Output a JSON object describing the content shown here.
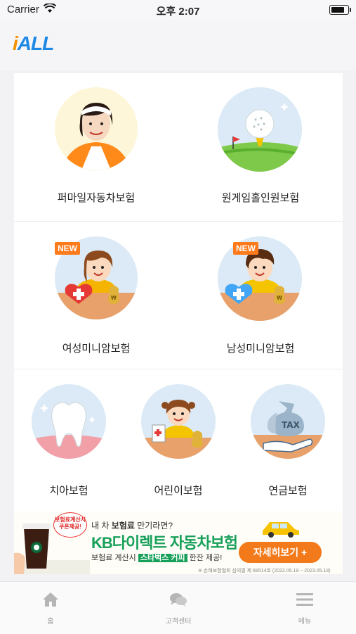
{
  "status_bar": {
    "carrier": "Carrier",
    "time": "오후 2:07"
  },
  "header": {
    "logo_prefix": "i",
    "logo_suffix": "ALL"
  },
  "products": {
    "row1": [
      {
        "label": "퍼마일자동차보험",
        "icon": "woman-driver-icon"
      },
      {
        "label": "원게임홀인원보험",
        "icon": "golf-ball-icon"
      }
    ],
    "row2": [
      {
        "label": "여성미니암보험",
        "badge": "NEW",
        "icon": "woman-heart-icon"
      },
      {
        "label": "남성미니암보험",
        "badge": "NEW",
        "icon": "man-heart-icon"
      }
    ],
    "row3": [
      {
        "label": "치아보험",
        "icon": "tooth-icon"
      },
      {
        "label": "어린이보험",
        "icon": "child-icon"
      },
      {
        "label": "연금보험",
        "icon": "tax-money-bag-icon"
      }
    ]
  },
  "banner": {
    "coupon_line1": "보험료계산시",
    "coupon_line2": "쿠폰제공!",
    "line1_pre": "내 차 ",
    "line1_hl": "보험료",
    "line1_post": " 만기라면?",
    "headline": "KB다이렉트 자동차보험",
    "line3_pre": "보험료 계산시 ",
    "line3_hl": "스타벅스 커피",
    "line3_post": " 한잔 제공!",
    "cta": "자세히보기  +",
    "fine_print": "※ 손해보험협회 심의필 제 68514호 (2022.05.19 ~ 2023.05.18)"
  },
  "tabbar": [
    {
      "label": "홈",
      "icon": "home-icon"
    },
    {
      "label": "고객센터",
      "icon": "chat-bubbles-icon"
    },
    {
      "label": "메뉴",
      "icon": "hamburger-menu-icon"
    }
  ],
  "colors": {
    "brand_blue": "#1e88e5",
    "brand_orange": "#f39200",
    "cta_orange": "#f27a1a",
    "kb_green": "#16a05a"
  }
}
